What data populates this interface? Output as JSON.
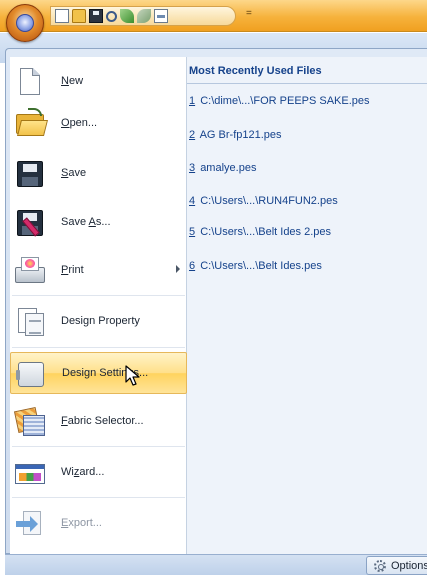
{
  "quick_access": {
    "icons": [
      "new-icon",
      "open-icon",
      "save-icon",
      "zoom-icon",
      "undo-icon",
      "redo-icon",
      "view-icon"
    ],
    "customize_glyph": "="
  },
  "menu": {
    "items": [
      {
        "id": "new",
        "pre": "",
        "key": "N",
        "post": "ew",
        "icon": "new-document-icon",
        "submenu": false,
        "disabled": false
      },
      {
        "id": "open",
        "pre": "",
        "key": "O",
        "post": "pen...",
        "icon": "open-folder-icon",
        "submenu": false,
        "disabled": false
      },
      {
        "id": "save",
        "pre": "",
        "key": "S",
        "post": "ave",
        "icon": "save-floppy-icon",
        "submenu": false,
        "disabled": false
      },
      {
        "id": "save-as",
        "pre": "Save ",
        "key": "A",
        "post": "s...",
        "icon": "save-as-icon",
        "submenu": false,
        "disabled": false
      },
      {
        "id": "print",
        "pre": "",
        "key": "P",
        "post": "rint",
        "icon": "printer-icon",
        "submenu": true,
        "disabled": false
      },
      {
        "id": "design-property",
        "pre": "Design Property",
        "key": "",
        "post": "",
        "icon": "design-property-icon",
        "submenu": false,
        "disabled": false
      },
      {
        "id": "design-settings",
        "pre": "Design Settings...",
        "key": "",
        "post": "",
        "icon": "design-settings-icon",
        "submenu": false,
        "disabled": false
      },
      {
        "id": "fabric-selector",
        "pre": "",
        "key": "F",
        "post": "abric Selector...",
        "icon": "fabric-selector-icon",
        "submenu": false,
        "disabled": false
      },
      {
        "id": "wizard",
        "pre": "Wi",
        "key": "z",
        "post": "ard...",
        "icon": "wizard-icon",
        "submenu": false,
        "disabled": false
      },
      {
        "id": "export",
        "pre": "",
        "key": "E",
        "post": "xport...",
        "icon": "export-icon",
        "submenu": false,
        "disabled": true
      }
    ],
    "hovered": "design-settings"
  },
  "recent": {
    "title": "Most Recently Used Files",
    "files": [
      {
        "num": "1",
        "path": "C:\\dime\\...\\FOR PEEPS SAKE.pes"
      },
      {
        "num": "2",
        "path": "AG Br-fp121.pes"
      },
      {
        "num": "3",
        "path": "amalye.pes"
      },
      {
        "num": "4",
        "path": "C:\\Users\\...\\RUN4FUN2.pes"
      },
      {
        "num": "5",
        "path": "C:\\Users\\...\\Belt Ides 2.pes"
      },
      {
        "num": "6",
        "path": "C:\\Users\\...\\Belt Ides.pes"
      }
    ]
  },
  "footer": {
    "options_label": "Options"
  },
  "colors": {
    "title_bar": "#f6b23c",
    "recent_text": "#15428b",
    "hover_highlight": "#ffe08a"
  }
}
